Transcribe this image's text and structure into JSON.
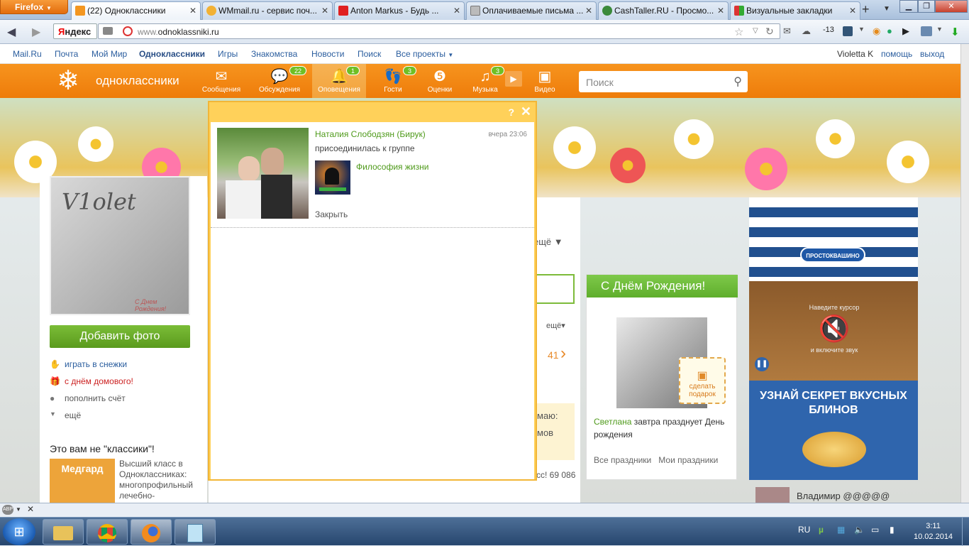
{
  "browser": {
    "menu_button": "Firefox",
    "tabs": [
      {
        "title": "(22) Одноклассники",
        "active": true,
        "icon_color": "#f39620"
      },
      {
        "title": "WMmail.ru - сервис поч...",
        "active": false,
        "icon_color": "#f2b134"
      },
      {
        "title": "Anton Markus - Будь ...",
        "active": false,
        "icon_color": "#e02020"
      },
      {
        "title": "Оплачиваемые письма ...",
        "active": false,
        "icon_color": "#8a8a8a"
      },
      {
        "title": "CashTaller.RU - Просмо...",
        "active": false,
        "icon_color": "#3b8a3b"
      },
      {
        "title": "Визуальные закладки",
        "active": false,
        "icon_color": "#d94"
      }
    ],
    "yandex_label_first": "Я",
    "yandex_label_rest": "ндекс",
    "url_prefix": "www.",
    "url_domain": "odnoklassniki.ru",
    "weather": "-13"
  },
  "site_nav": {
    "links": [
      "Mail.Ru",
      "Почта",
      "Мой Мир",
      "Одноклассники",
      "Игры",
      "Знакомства",
      "Новости",
      "Поиск",
      "Все проекты"
    ],
    "user": "Violetta K",
    "help": "помощь",
    "logout": "выход"
  },
  "ok_header": {
    "logo_text": "одноклассники",
    "items": [
      {
        "label": "Сообщения",
        "badge": ""
      },
      {
        "label": "Обсуждения",
        "badge": "22"
      },
      {
        "label": "Оповещения",
        "badge": "1"
      },
      {
        "label": "Гости",
        "badge": "3"
      },
      {
        "label": "Оценки",
        "badge": ""
      },
      {
        "label": "Музыка",
        "badge": "3"
      },
      {
        "label": "Видео",
        "badge": ""
      }
    ],
    "search_placeholder": "Поиск"
  },
  "left": {
    "photo_text": "V1olet",
    "photo_caption": "С Днем Рождения!",
    "add_photo": "Добавить фото",
    "menu": [
      "играть в снежки",
      "с днём домового!",
      "пополнить счёт",
      "ещё"
    ],
    "classmates_title": "Это вам не \"классики\"!",
    "promo_logo": "Медгард",
    "promo_text": "Высший класс в Одноклассниках: многопрофильный лечебно-"
  },
  "middle_ghost": {
    "more": "ещё",
    "more2": "ещё",
    "num": "41",
    "text1": "маю:",
    "text2": "мов",
    "bottom": "сс! 69 086"
  },
  "birthday": {
    "title": "С Днём Рождения!",
    "gift": "сделать подарок",
    "name": "Светлана",
    "text": "завтра празднует День рождения",
    "link_all": "Все праздники",
    "link_mine": "Мои праздники"
  },
  "ad": {
    "brand": "ПРОСТОКВАШИНО",
    "overlay_top": "Наведите курсор",
    "overlay_bottom": "и включите звук",
    "title": "УЗНАЙ СЕКРЕТ ВКУСНЫХ БЛИНОВ"
  },
  "friend_name": "Владимир @@@@@",
  "popup": {
    "help": "?",
    "close": "✕",
    "notification": {
      "name": "Наталия Слободзян (Бирук)",
      "time": "вчера 23:06",
      "action": "присоединилась к группе",
      "group": "Философия жизни",
      "close_link": "Закрыть"
    }
  },
  "taskbar": {
    "lang": "RU",
    "time": "3:11",
    "date": "10.02.2014"
  }
}
